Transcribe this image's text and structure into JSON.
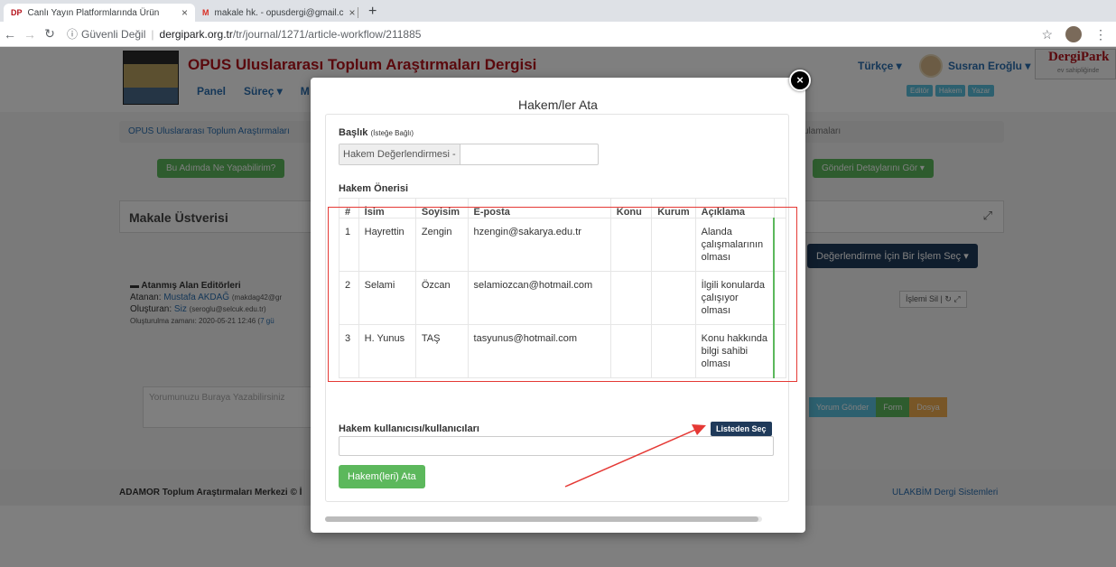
{
  "browser": {
    "tabs": [
      {
        "favicon": "DP",
        "title": "Canlı Yayın Platformlarında Ürün",
        "active": true
      },
      {
        "favicon": "M",
        "title": "makale hk. - opusdergi@gmail.c",
        "active": false
      }
    ],
    "url": {
      "security": "Güvenli Değil",
      "domain": "dergipark.org.tr",
      "path": "/tr/journal/1271/article-workflow/211885"
    }
  },
  "header": {
    "journal_title": "OPUS Uluslararası Toplum Araştırmaları Dergisi",
    "nav": [
      "Panel",
      "Süreç ▾",
      "M"
    ],
    "language": "Türkçe ▾",
    "user": "Susran Eroğlu ▾",
    "brand": "DergiPark",
    "brand_sub": "ev sahipliğinde",
    "roles": [
      "Editör",
      "Hakem",
      "Yazar"
    ]
  },
  "page": {
    "breadcrumb": "OPUS Uluslararası Toplum Araştırmaları",
    "breadcrumb_right": "ulamaları",
    "help_btn": "Bu Adımda Ne Yapabilirim?",
    "details_btn": "Gönderi Detaylarını Gör ▾",
    "metadata_title": "Makale Üstverisi",
    "eval_btn": "Değerlendirme İçin Bir İşlem Seç ▾",
    "editors": {
      "title": "Atanmış Alan Editörleri",
      "assignee_label": "Atanan:",
      "assignee": "Mustafa AKDAĞ",
      "assignee_email": "(makdag42@gr",
      "creator_label": "Oluşturan:",
      "creator": "Siz",
      "creator_email": "(seroglu@selcuk.edu.tr)",
      "created": "Oluşturulma zamanı: 2020-05-21 12:46 (",
      "created_ago": "7 gü"
    },
    "islemi_sil": "İşlemi Sil",
    "comment_placeholder": "Yorumunuzu Buraya Yazabilirsiniz",
    "comment_buttons": [
      "Yorum Gönder",
      "Form",
      "Dosya"
    ],
    "footer_left": "ADAMOR Toplum Araştırmaları Merkezi © İ",
    "footer_right": "ULAKBİM Dergi Sistemleri"
  },
  "modal": {
    "title": "Hakem/ler Ata",
    "title_label": "Başlık",
    "title_label_sub": "(İsteğe Bağlı)",
    "title_prefix": "Hakem Değerlendirmesi -",
    "title_value": "",
    "suggestions_label": "Hakem Önerisi",
    "columns": [
      "#",
      "İsim",
      "Soyisim",
      "E-posta",
      "Konu",
      "Kurum",
      "Açıklama"
    ],
    "rows": [
      {
        "no": "1",
        "name": "Hayrettin",
        "surname": "Zengin",
        "email": "hzengin@sakarya.edu.tr",
        "topic": "",
        "org": "",
        "note": "Alanda çalışmalarının olması"
      },
      {
        "no": "2",
        "name": "Selami",
        "surname": "Özcan",
        "email": "selamiozcan@hotmail.com",
        "topic": "",
        "org": "",
        "note": "İlgili konularda çalışıyor olması"
      },
      {
        "no": "3",
        "name": "H. Yunus",
        "surname": "TAŞ",
        "email": "tasyunus@hotmail.com",
        "topic": "",
        "org": "",
        "note": "Konu hakkında bilgi sahibi olması"
      }
    ],
    "users_label": "Hakem kullanıcısı/kullanıcıları",
    "select_btn": "Listeden Seç",
    "users_value": "",
    "assign_btn": "Hakem(leri) Ata",
    "close": "×"
  },
  "annotation_color": "#e53935"
}
